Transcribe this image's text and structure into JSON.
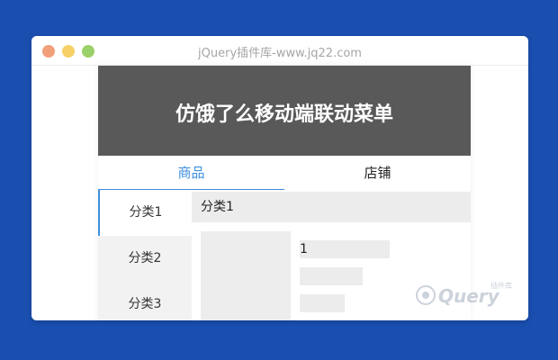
{
  "window": {
    "title": "jQuery插件库-www.jq22.com"
  },
  "page": {
    "header_title": "仿饿了么移动端联动菜单",
    "tabs": [
      {
        "label": "商品",
        "active": true
      },
      {
        "label": "店铺",
        "active": false
      }
    ],
    "categories": [
      {
        "label": "分类1",
        "active": true
      },
      {
        "label": "分类2",
        "active": false
      },
      {
        "label": "分类3",
        "active": false
      }
    ],
    "section_title": "分类1",
    "items": [
      {
        "name": "1"
      }
    ]
  },
  "watermark": {
    "brand": "jQuery",
    "subtitle": "插件库"
  },
  "colors": {
    "background": "#1a4fb0",
    "header": "#595959",
    "accent": "#3d8fe0",
    "placeholder": "#ececec"
  }
}
